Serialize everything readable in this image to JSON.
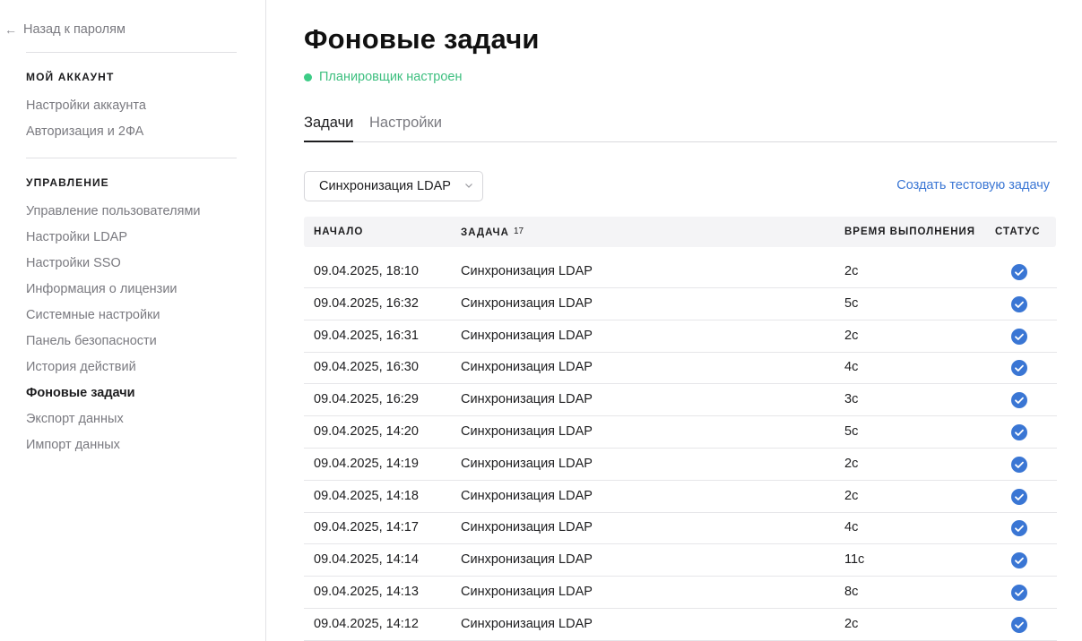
{
  "sidebar": {
    "back_label": "Назад к паролям",
    "sections": [
      {
        "title": "МОЙ АККАУНТ",
        "items": [
          {
            "label": "Настройки аккаунта"
          },
          {
            "label": "Авторизация и 2ФА"
          }
        ]
      },
      {
        "title": "УПРАВЛЕНИЕ",
        "items": [
          {
            "label": "Управление пользователями"
          },
          {
            "label": "Настройки LDAP"
          },
          {
            "label": "Настройки SSO"
          },
          {
            "label": "Информация о лицензии"
          },
          {
            "label": "Системные настройки"
          },
          {
            "label": "Панель безопасности"
          },
          {
            "label": "История действий"
          },
          {
            "label": "Фоновые задачи",
            "active": true
          },
          {
            "label": "Экспорт данных"
          },
          {
            "label": "Импорт данных"
          }
        ]
      }
    ]
  },
  "main": {
    "title": "Фоновые задачи",
    "status": "Планировщик настроен",
    "tabs": [
      {
        "label": "Задачи",
        "active": true
      },
      {
        "label": "Настройки"
      }
    ],
    "filter": {
      "selected": "Синхронизация LDAP"
    },
    "create_label": "Создать тестовую задачу",
    "table": {
      "columns": {
        "start": "НАЧАЛО",
        "task": "ЗАДАЧА",
        "task_count": "17",
        "duration": "ВРЕМЯ ВЫПОЛНЕНИЯ",
        "status": "СТАТУС"
      },
      "rows": [
        {
          "start": "09.04.2025, 18:10",
          "task": "Синхронизация LDAP",
          "duration": "2с",
          "status": "success"
        },
        {
          "start": "09.04.2025, 16:32",
          "task": "Синхронизация LDAP",
          "duration": "5с",
          "status": "success"
        },
        {
          "start": "09.04.2025, 16:31",
          "task": "Синхронизация LDAP",
          "duration": "2с",
          "status": "success"
        },
        {
          "start": "09.04.2025, 16:30",
          "task": "Синхронизация LDAP",
          "duration": "4с",
          "status": "success"
        },
        {
          "start": "09.04.2025, 16:29",
          "task": "Синхронизация LDAP",
          "duration": "3с",
          "status": "success"
        },
        {
          "start": "09.04.2025, 14:20",
          "task": "Синхронизация LDAP",
          "duration": "5с",
          "status": "success"
        },
        {
          "start": "09.04.2025, 14:19",
          "task": "Синхронизация LDAP",
          "duration": "2с",
          "status": "success"
        },
        {
          "start": "09.04.2025, 14:18",
          "task": "Синхронизация LDAP",
          "duration": "2с",
          "status": "success"
        },
        {
          "start": "09.04.2025, 14:17",
          "task": "Синхронизация LDAP",
          "duration": "4с",
          "status": "success"
        },
        {
          "start": "09.04.2025, 14:14",
          "task": "Синхронизация LDAP",
          "duration": "11с",
          "status": "success"
        },
        {
          "start": "09.04.2025, 14:13",
          "task": "Синхронизация LDAP",
          "duration": "8с",
          "status": "success"
        },
        {
          "start": "09.04.2025, 14:12",
          "task": "Синхронизация LDAP",
          "duration": "2с",
          "status": "success"
        }
      ]
    }
  },
  "colors": {
    "accent": "#3a76d4",
    "success": "#3dbf7f",
    "status_icon": "#3a76d4"
  },
  "icons": {
    "back": "arrow-left-icon",
    "select": "chevron-down-icon",
    "status": "check-circle-icon"
  }
}
